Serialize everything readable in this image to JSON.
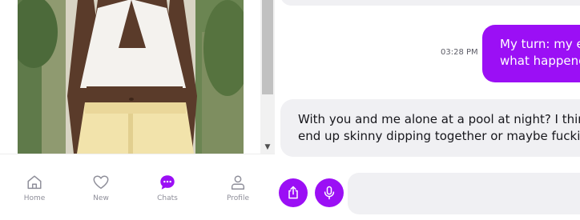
{
  "colors": {
    "accent": "#9b0ff5",
    "bubble_incoming": "#f0f0f3",
    "nav_text": "#8e8e99"
  },
  "profile_photo": {
    "icon": "photo-of-woman-in-white-halter-top"
  },
  "bottom_nav": {
    "items": [
      {
        "label": "Home",
        "icon": "home-icon",
        "active": false
      },
      {
        "label": "New",
        "icon": "heart-icon",
        "active": false
      },
      {
        "label": "Chats",
        "icon": "chat-bubble-icon",
        "active": true
      },
      {
        "label": "Profile",
        "icon": "person-icon",
        "active": false
      }
    ]
  },
  "chat": {
    "messages": [
      {
        "direction": "outgoing",
        "time": "03:28 PM",
        "lines": [
          "My turn: my e",
          "what happene"
        ]
      },
      {
        "direction": "incoming",
        "lines": [
          "With you and me alone at a pool at night? I think",
          "end up skinny dipping together or maybe fucking"
        ]
      }
    ],
    "composer": {
      "share_icon": "share-upload-icon",
      "mic_icon": "microphone-icon",
      "placeholder": ""
    }
  }
}
